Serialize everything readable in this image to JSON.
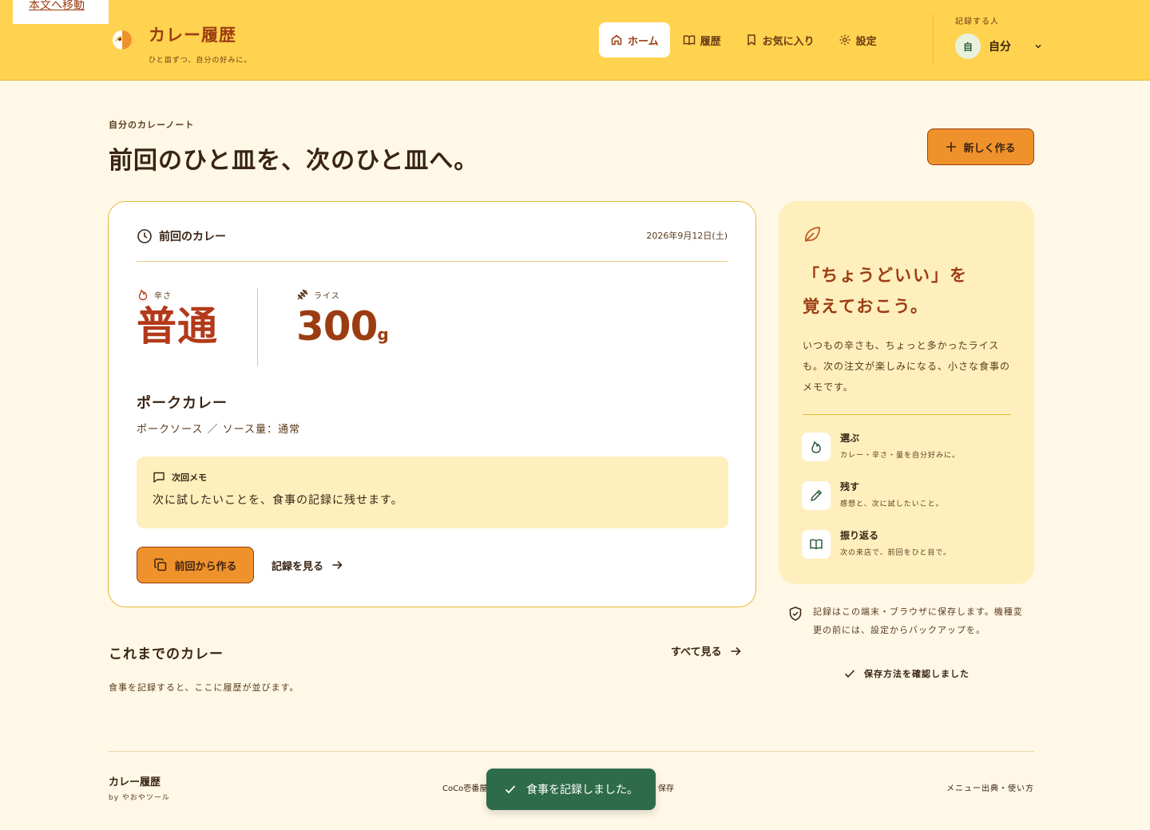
{
  "skip_link": "本文へ移動",
  "brand": {
    "title": "カレー履歴",
    "tagline": "ひと皿ずつ、自分の好みに。"
  },
  "nav": [
    {
      "label": "ホーム",
      "icon": "home-icon",
      "active": true
    },
    {
      "label": "履歴",
      "icon": "book-icon",
      "active": false
    },
    {
      "label": "お気に入り",
      "icon": "bookmark-icon",
      "active": false
    },
    {
      "label": "設定",
      "icon": "gear-icon",
      "active": false
    }
  ],
  "recorder": {
    "label": "記録する人",
    "avatar": "自",
    "name": "自分"
  },
  "hero": {
    "eyebrow": "自分のカレーノート",
    "title": "前回のひと皿を、次のひと皿へ。",
    "new_button": "新しく作る"
  },
  "last_curry": {
    "heading": "前回のカレー",
    "date": "2026年9月12日(土)",
    "spice_label": "辛さ",
    "spice_value": "普通",
    "rice_label": "ライス",
    "rice_value": "300",
    "rice_unit": "g",
    "dish_name": "ポークカレー",
    "dish_detail": "ポークソース ／ ソース量：通常",
    "memo_label": "次回メモ",
    "memo_text": "次に試したいことを、食事の記録に残せます。",
    "copy_button": "前回から作る",
    "history_link": "記録を見る"
  },
  "past": {
    "title": "これまでのカレー",
    "see_all": "すべて見る",
    "empty": "食事を記録すると、ここに履歴が並びます。"
  },
  "side": {
    "title_line1": "「ちょうどいい」を",
    "title_line2": "覚えておこう。",
    "description": "いつもの辛さも、ちょっと多かったライスも。次の注文が楽しみになる、小さな食事のメモです。",
    "features": [
      {
        "title": "選ぶ",
        "desc": "カレー・辛さ・量を自分好みに。",
        "icon": "flame-icon"
      },
      {
        "title": "残す",
        "desc": "感想と、次に試したいこと。",
        "icon": "pencil-icon"
      },
      {
        "title": "振り返る",
        "desc": "次の来店で、前回をひと目で。",
        "icon": "book-open-icon"
      }
    ]
  },
  "privacy": {
    "text": "記録はこの端末・ブラウザに保存します。機種変更の前には、設定からバックアップを。",
    "confirm": "保存方法を確認しました"
  },
  "footer": {
    "brand": "カレー履歴",
    "by": "by やおやツール",
    "center_left": "CoCo壱番屋",
    "center_right": "保存",
    "right": "メニュー出典・使い方"
  },
  "toast": "食事を記録しました。",
  "colors": {
    "header_bg": "#ffd34f",
    "page_bg": "#fff8e6",
    "accent": "#f0922b",
    "brand_text": "#9b3d12",
    "toast_bg": "#2e6b4a"
  }
}
